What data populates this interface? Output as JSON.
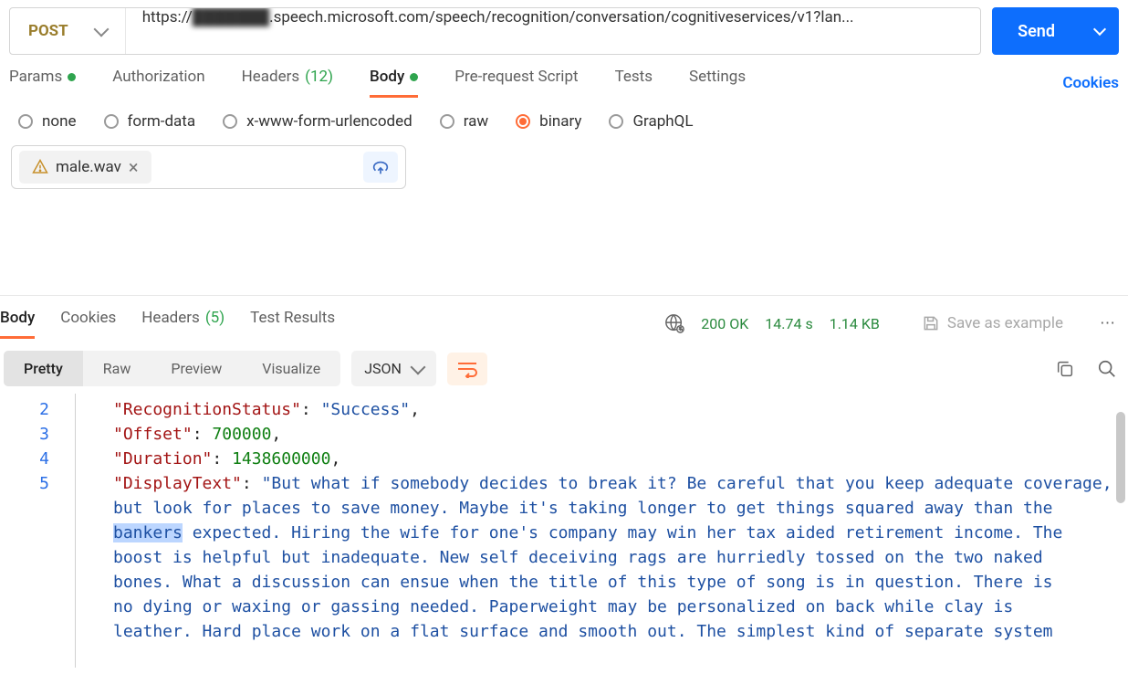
{
  "request": {
    "method": "POST",
    "url_prefix": "https://",
    "url_host_blurred": "███████",
    "url_rest": ".speech.microsoft.com/speech/recognition/conversation/cognitiveservices/v1?lan..."
  },
  "send_label": "Send",
  "tabs": {
    "params": "Params",
    "authorization": "Authorization",
    "headers": "Headers",
    "headers_count": "(12)",
    "body": "Body",
    "prerequest": "Pre-request Script",
    "tests": "Tests",
    "settings": "Settings",
    "cookies": "Cookies"
  },
  "body_types": {
    "none": "none",
    "formdata": "form-data",
    "xwww": "x-www-form-urlencoded",
    "raw": "raw",
    "binary": "binary",
    "graphql": "GraphQL"
  },
  "file": {
    "name": "male.wav"
  },
  "response_tabs": {
    "body": "Body",
    "cookies": "Cookies",
    "headers": "Headers",
    "headers_count": "(5)",
    "test_results": "Test Results"
  },
  "status": {
    "code": "200 OK",
    "time": "14.74 s",
    "size": "1.14 KB",
    "save_example": "Save as example"
  },
  "view": {
    "pretty": "Pretty",
    "raw": "Raw",
    "preview": "Preview",
    "visualize": "Visualize",
    "format": "JSON"
  },
  "json": {
    "line_numbers": [
      "2",
      "3",
      "4",
      "5"
    ],
    "keys": {
      "recognition": "\"RecognitionStatus\"",
      "offset": "\"Offset\"",
      "duration": "\"Duration\"",
      "display": "\"DisplayText\""
    },
    "values": {
      "recognition": "\"Success\"",
      "offset": "700000",
      "duration": "1438600000",
      "display_start": "\"But what if somebody decides to break it? Be careful that you keep adequate coverage,",
      "display_wrap1_a": "but look for places to save money. Maybe it's taking longer to get things squared away than the",
      "display_wrap2_hl": "bankers",
      "display_wrap2_b": " expected. Hiring the wife for one's company may win her tax aided retirement income. The",
      "display_wrap3": "boost is helpful but inadequate. New self deceiving rags are hurriedly tossed on the two naked",
      "display_wrap4": "bones. What a discussion can ensue when the title of this type of song is in question. There is",
      "display_wrap5": "no dying or waxing or gassing needed. Paperweight may be personalized on back while clay is",
      "display_wrap6": "leather. Hard place work on a flat surface and smooth out. The simplest kind of separate system"
    }
  }
}
